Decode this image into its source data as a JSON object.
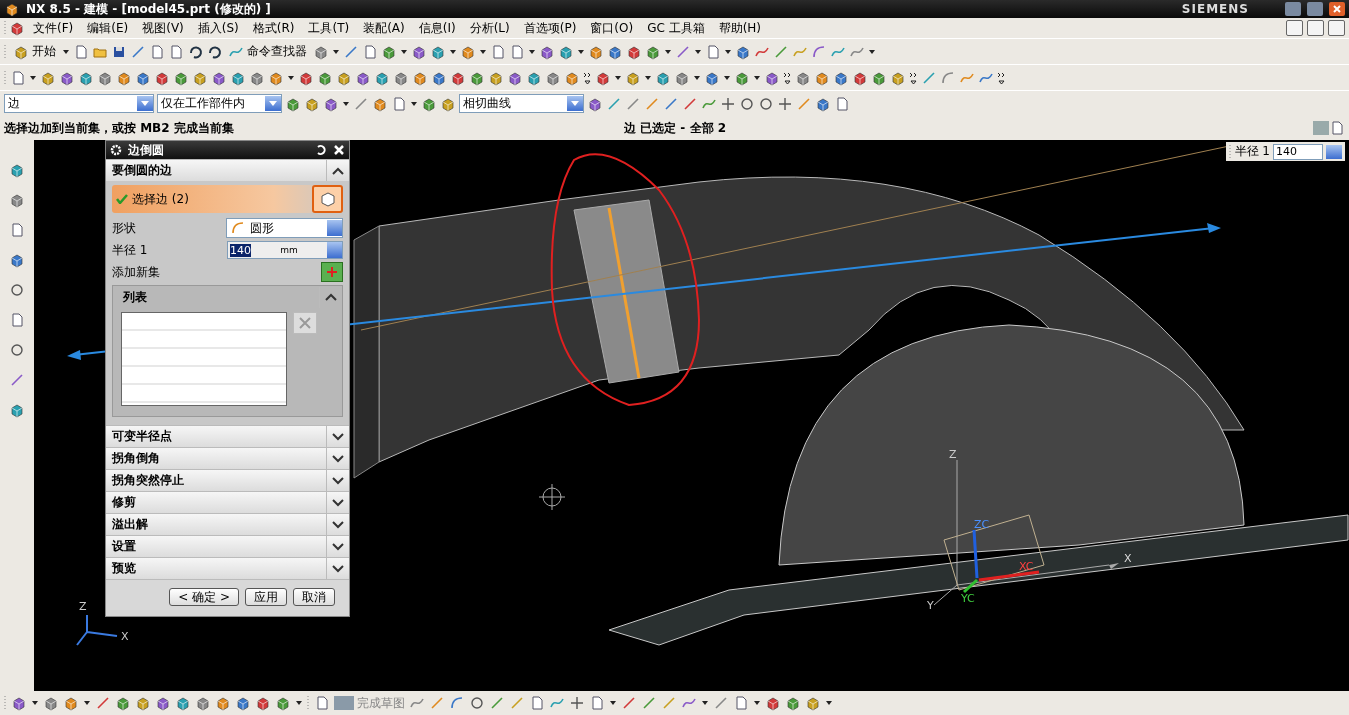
{
  "window": {
    "title": "NX 8.5 - 建模 - [model45.prt (修改的) ]",
    "brand": "SIEMENS"
  },
  "menu": [
    "文件(F)",
    "编辑(E)",
    "视图(V)",
    "插入(S)",
    "格式(R)",
    "工具(T)",
    "装配(A)",
    "信息(I)",
    "分析(L)",
    "首选项(P)",
    "窗口(O)",
    "GC 工具箱",
    "帮助(H)"
  ],
  "toolbar": {
    "start": "开始",
    "command_finder": "命令查找器"
  },
  "selection_bar": {
    "type_filter": "边",
    "scope": "仅在工作部件内",
    "curve_rule": "相切曲线"
  },
  "cue_line": "选择边加到当前集，或按 MB2 完成当前集",
  "status_line": "边 已选定 - 全部 2",
  "dialog": {
    "title": "边倒圆",
    "group": {
      "title": "要倒圆的边",
      "expanded": true
    },
    "select": {
      "label": "选择边 (2)",
      "active": true
    },
    "shape": {
      "label": "形状",
      "value": "圆形"
    },
    "radius": {
      "label": "半径 1",
      "value": "140",
      "unit": "mm"
    },
    "add_set": "添加新集",
    "list": {
      "title": "列表",
      "expanded": true
    },
    "sections": [
      {
        "title": "可变半径点",
        "expanded": false
      },
      {
        "title": "拐角倒角",
        "expanded": false
      },
      {
        "title": "拐角突然停止",
        "expanded": false
      },
      {
        "title": "修剪",
        "expanded": false
      },
      {
        "title": "溢出解",
        "expanded": false
      },
      {
        "title": "设置",
        "expanded": false
      },
      {
        "title": "预览",
        "expanded": false
      }
    ],
    "buttons": [
      "< 确定 >",
      "应用",
      "取消"
    ]
  },
  "radius_field": {
    "label": "半径 1",
    "value": "140"
  },
  "viewport": {
    "wcs_labels": [
      "Z",
      "ZC",
      "XC",
      "X",
      "YC",
      "Y"
    ],
    "triad_labels": [
      "Z",
      "X"
    ]
  },
  "bottom_toolbar": {
    "finish_sketch": "完成草图"
  }
}
